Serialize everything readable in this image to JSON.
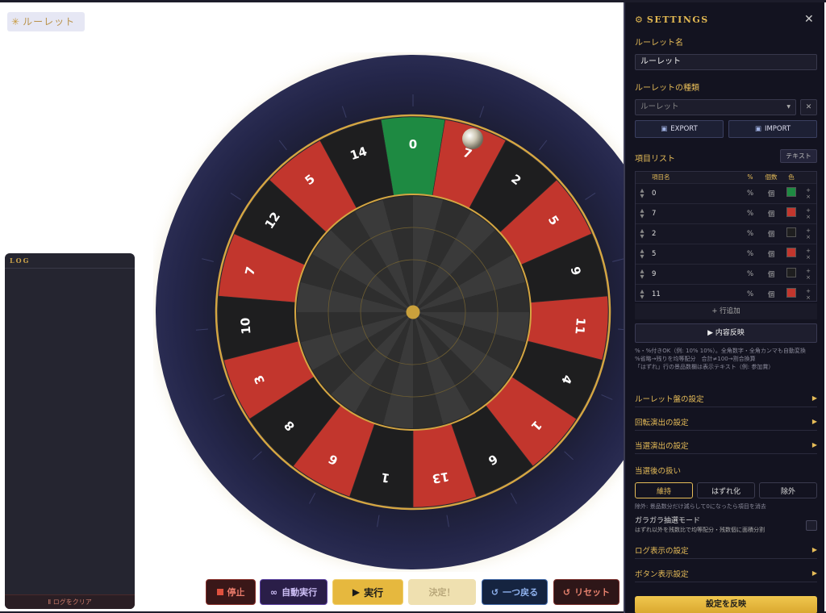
{
  "header": {
    "title": "ルーレット",
    "spark": "✳"
  },
  "log": {
    "title": "LOG",
    "clear_label": "Ⅱ ログをクリア"
  },
  "colors": {
    "red": "#c2362d",
    "black": "#1e1e1f",
    "green": "#1e8a42",
    "gold": "#d4a642"
  },
  "wheel": {
    "outer_labels": [
      "0",
      "7",
      "2",
      "5",
      "9",
      "11",
      "4",
      "1",
      "6",
      "13",
      "1",
      "6",
      "8",
      "3",
      "10",
      "7",
      "12",
      "5",
      "14"
    ],
    "outer_colors": [
      "green",
      "red",
      "black",
      "red",
      "black",
      "red",
      "black",
      "red",
      "black",
      "red",
      "black",
      "red",
      "black",
      "red",
      "black",
      "red",
      "black",
      "red",
      "black"
    ]
  },
  "buttons": {
    "stop": "停止",
    "auto": "自動実行",
    "run": "実行",
    "decide": "決定！",
    "back": "一つ戻る",
    "reset": "リセット"
  },
  "settings": {
    "title": "SETTINGS",
    "name_label": "ルーレット名",
    "name_value": "ルーレット",
    "type_label": "ルーレットの種類",
    "type_value": "ルーレット",
    "export": "EXPORT",
    "import": "IMPORT",
    "items_label": "項目リスト",
    "text_btn": "テキスト",
    "col_name": "項目名",
    "col_pct": "%",
    "col_count": "個数",
    "col_color": "色",
    "items": [
      {
        "name": "0",
        "pct": "%",
        "cnt": "個",
        "color": "#1e8a42"
      },
      {
        "name": "7",
        "pct": "%",
        "cnt": "個",
        "color": "#c2362d"
      },
      {
        "name": "2",
        "pct": "%",
        "cnt": "個",
        "color": "#1e1e1f"
      },
      {
        "name": "5",
        "pct": "%",
        "cnt": "個",
        "color": "#c2362d"
      },
      {
        "name": "9",
        "pct": "%",
        "cnt": "個",
        "color": "#1e1e1f"
      },
      {
        "name": "11",
        "pct": "%",
        "cnt": "個",
        "color": "#c2362d"
      }
    ],
    "add_row": "+ 行追加",
    "apply_content": "▶ 内容反映",
    "help1": "%・%付きOK（例: 10% 10%）。全角数字・全角カンマも自動変換",
    "help2": "%省略→残りを均等配分　合計≠100→割合換算",
    "help3": "「はずれ」行の景品数欄は表示テキスト（例: 参加賞）",
    "sec_board": "ルーレット盤の設定",
    "sec_spin": "回転演出の設定",
    "sec_win": "当選演出の設定",
    "after_label": "当選後の扱い",
    "after_keep": "維持",
    "after_miss": "はずれ化",
    "after_remove": "除外",
    "after_help": "除外: 景品数分だけ減らして0になったら項目を消去",
    "gara_title": "ガラガラ抽選モード",
    "gara_help": "はずれ以外を残数比で均等配分・残数個に面積分割",
    "sec_log": "ログ表示の設定",
    "sec_button": "ボタン表示設定",
    "apply": "設定を反映"
  }
}
